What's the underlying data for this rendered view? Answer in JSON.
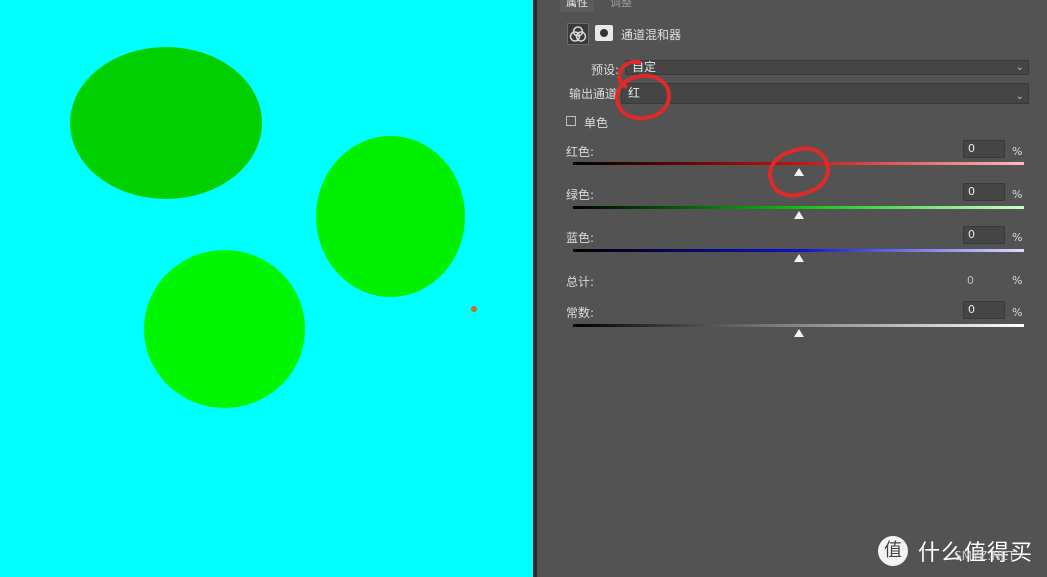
{
  "canvas": {
    "background": "#00ffff",
    "shapes": [
      {
        "name": "ellipse-dark-green",
        "color": "#00d000"
      },
      {
        "name": "ellipse-green-right",
        "color": "#00f000"
      },
      {
        "name": "ellipse-green-bottom",
        "color": "#00f500"
      }
    ],
    "speck_color": "#c0703a"
  },
  "panel": {
    "tabs": [
      {
        "label": "属性",
        "active": true
      },
      {
        "label": "调整",
        "active": false
      }
    ],
    "title": "通道混和器",
    "icons": {
      "adjustment": "channel-mixer-icon",
      "mask": "layer-mask-icon"
    },
    "preset": {
      "label": "预设:",
      "value": "自定"
    },
    "output_channel": {
      "label": "输出通道",
      "value": "红"
    },
    "monochrome": {
      "label": "单色",
      "checked": false
    },
    "sliders": [
      {
        "label": "红色:",
        "value": "0",
        "unit": "%",
        "position": 0.5,
        "gradient": [
          "#000000",
          "#c81010",
          "#ffbcbc"
        ]
      },
      {
        "label": "绿色:",
        "value": "0",
        "unit": "%",
        "position": 0.5,
        "gradient": [
          "#000000",
          "#10c010",
          "#c8ffc8"
        ]
      },
      {
        "label": "蓝色:",
        "value": "0",
        "unit": "%",
        "position": 0.5,
        "gradient": [
          "#000000",
          "#1010c8",
          "#dcdcff"
        ]
      }
    ],
    "total": {
      "label": "总计:",
      "value": "0",
      "unit": "%"
    },
    "constant": {
      "label": "常数:",
      "value": "0",
      "unit": "%",
      "position": 0.5,
      "gradient": [
        "#000000",
        "#888888",
        "#ffffff"
      ]
    },
    "annotation_color": "#e02a2a"
  },
  "watermark": {
    "logo": "值",
    "text": "什么值得买",
    "sub": "SMYZ.NET"
  }
}
